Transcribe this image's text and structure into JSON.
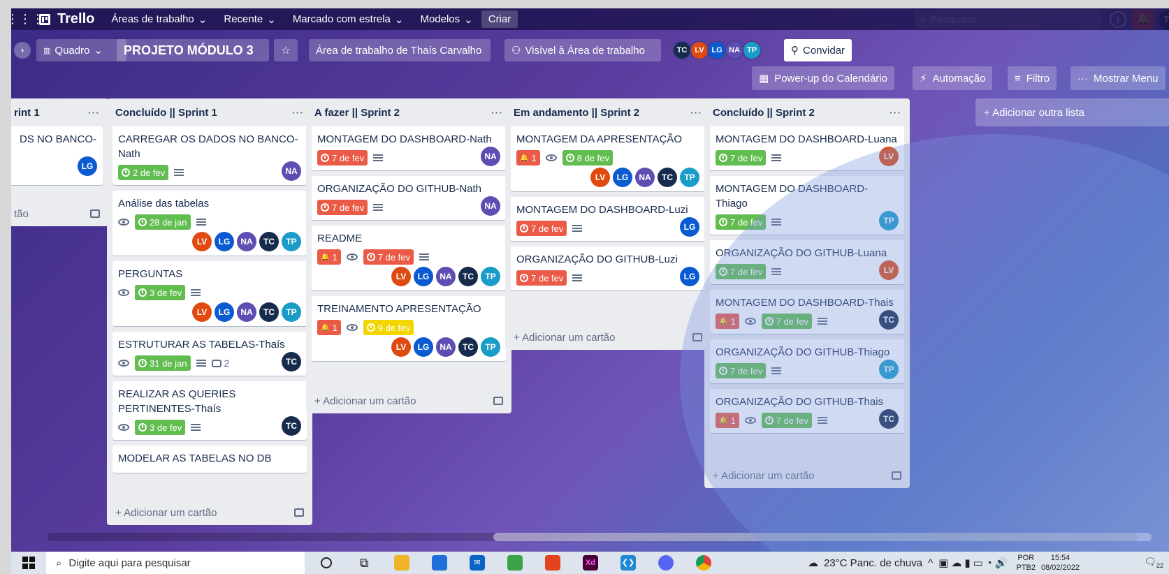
{
  "topbar": {
    "brand": "Trello",
    "nav": [
      "Áreas de trabalho",
      "Recente",
      "Marcado com estrela",
      "Modelos"
    ],
    "create": "Criar",
    "search_placeholder": "Pesquisar",
    "info": "i",
    "user_initials": "TC"
  },
  "board": {
    "view": "Quadro",
    "title": "PROJETO MÓDULO 3",
    "workspace": "Área de trabalho de Thaís Carvalho",
    "visibility": "Visível à Área de trabalho",
    "members": [
      "TC",
      "LV",
      "LG",
      "NA",
      "TP"
    ],
    "invite": "Convidar",
    "calendar": "Power-up do Calendário",
    "automation": "Automação",
    "filter": "Filtro",
    "show_menu": "Mostrar Menu",
    "add_list": "+ Adicionar outra lista"
  },
  "add_card_label": "+ Adicionar um cartão",
  "list0": {
    "title": "rint 1",
    "card0": {
      "title": "DS NO BANCO-",
      "members": [
        "LG"
      ]
    },
    "add": "tão"
  },
  "lists": [
    {
      "title": "Concluído || Sprint 1",
      "cards": [
        {
          "title": "CARREGAR OS DADOS NO BANCO-Nath",
          "badges": [
            {
              "type": "date",
              "color": "green",
              "text": "2 de fev"
            },
            {
              "type": "desc"
            }
          ],
          "members": [
            "NA"
          ]
        },
        {
          "title": "Análise das tabelas",
          "badges": [
            {
              "type": "watch"
            },
            {
              "type": "date",
              "color": "green",
              "text": "28 de jan"
            },
            {
              "type": "desc"
            }
          ],
          "members": [
            "LV",
            "LG",
            "NA",
            "TC",
            "TP"
          ]
        },
        {
          "title": "PERGUNTAS",
          "badges": [
            {
              "type": "watch"
            },
            {
              "type": "date",
              "color": "green",
              "text": "3 de fev"
            },
            {
              "type": "desc"
            }
          ],
          "members": [
            "LV",
            "LG",
            "NA",
            "TC",
            "TP"
          ]
        },
        {
          "title": "ESTRUTURAR AS TABELAS-Thaís",
          "badges": [
            {
              "type": "watch"
            },
            {
              "type": "date",
              "color": "green",
              "text": "31 de jan"
            },
            {
              "type": "desc"
            },
            {
              "type": "comment",
              "text": "2"
            }
          ],
          "members": [
            "TC"
          ]
        },
        {
          "title": "REALIZAR AS QUERIES PERTINENTES-Thaís",
          "badges": [
            {
              "type": "watch"
            },
            {
              "type": "date",
              "color": "green",
              "text": "3 de fev"
            },
            {
              "type": "desc"
            }
          ],
          "members": [
            "TC"
          ]
        },
        {
          "title": "MODELAR AS TABELAS NO DB",
          "badges": [],
          "members": []
        }
      ]
    },
    {
      "title": "A fazer || Sprint 2",
      "cards": [
        {
          "title": "MONTAGEM DO DASHBOARD-Nath",
          "badges": [
            {
              "type": "date",
              "color": "red",
              "text": "7 de fev"
            },
            {
              "type": "desc"
            }
          ],
          "members": [
            "NA"
          ]
        },
        {
          "title": "ORGANIZAÇÃO DO GITHUB-Nath",
          "badges": [
            {
              "type": "date",
              "color": "red",
              "text": "7 de fev"
            },
            {
              "type": "desc"
            }
          ],
          "members": [
            "NA"
          ]
        },
        {
          "title": "README",
          "badges": [
            {
              "type": "alert",
              "text": "1"
            },
            {
              "type": "watch"
            },
            {
              "type": "date",
              "color": "red",
              "text": "7 de fev"
            },
            {
              "type": "desc"
            }
          ],
          "members": [
            "LV",
            "LG",
            "NA",
            "TC",
            "TP"
          ]
        },
        {
          "title": "TREINAMENTO APRESENTAÇÃO",
          "badges": [
            {
              "type": "alert",
              "text": "1"
            },
            {
              "type": "watch"
            },
            {
              "type": "date",
              "color": "yellow",
              "text": "9 de fev"
            }
          ],
          "members": [
            "LV",
            "LG",
            "NA",
            "TC",
            "TP"
          ]
        }
      ]
    },
    {
      "title": "Em andamento || Sprint 2",
      "cards": [
        {
          "title": "MONTAGEM DA APRESENTAÇÃO",
          "badges": [
            {
              "type": "alert",
              "text": "1"
            },
            {
              "type": "watch"
            },
            {
              "type": "date",
              "color": "green",
              "text": "8 de fev"
            }
          ],
          "members": [
            "LV",
            "LG",
            "NA",
            "TC",
            "TP"
          ]
        },
        {
          "title": "MONTAGEM DO DASHBOARD-Luzi",
          "badges": [
            {
              "type": "date",
              "color": "red",
              "text": "7 de fev"
            },
            {
              "type": "desc"
            }
          ],
          "members": [
            "LG"
          ]
        },
        {
          "title": "ORGANIZAÇÃO DO GITHUB-Luzi",
          "badges": [
            {
              "type": "date",
              "color": "red",
              "text": "7 de fev"
            },
            {
              "type": "desc"
            }
          ],
          "members": [
            "LG"
          ]
        }
      ]
    },
    {
      "title": "Concluído || Sprint 2",
      "cards": [
        {
          "title": "MONTAGEM DO DASHBOARD-Luana",
          "badges": [
            {
              "type": "date",
              "color": "green",
              "text": "7 de fev"
            },
            {
              "type": "desc"
            }
          ],
          "members": [
            "LV"
          ]
        },
        {
          "title": "MONTAGEM DO DASHBOARD-Thiago",
          "badges": [
            {
              "type": "date",
              "color": "green",
              "text": "7 de fev"
            },
            {
              "type": "desc"
            }
          ],
          "members": [
            "TP"
          ]
        },
        {
          "title": "ORGANIZAÇÃO DO GITHUB-Luana",
          "badges": [
            {
              "type": "date",
              "color": "green",
              "text": "7 de fev"
            },
            {
              "type": "desc"
            }
          ],
          "members": [
            "LV"
          ]
        },
        {
          "title": "MONTAGEM DO DASHBOARD-Thais",
          "badges": [
            {
              "type": "alert",
              "text": "1"
            },
            {
              "type": "watch"
            },
            {
              "type": "date",
              "color": "green",
              "text": "7 de fev"
            },
            {
              "type": "desc"
            }
          ],
          "members": [
            "TC"
          ]
        },
        {
          "title": "ORGANIZAÇÃO DO GITHUB-Thiago",
          "badges": [
            {
              "type": "date",
              "color": "green",
              "text": "7 de fev"
            },
            {
              "type": "desc"
            }
          ],
          "members": [
            "TP"
          ]
        },
        {
          "title": "ORGANIZAÇÃO DO GITHUB-Thais",
          "badges": [
            {
              "type": "alert",
              "text": "1"
            },
            {
              "type": "watch"
            },
            {
              "type": "date",
              "color": "green",
              "text": "7 de fev"
            },
            {
              "type": "desc"
            }
          ],
          "members": [
            "TC"
          ]
        }
      ]
    }
  ],
  "taskbar": {
    "search_placeholder": "Digite aqui para pesquisar",
    "apps": [
      "task-view",
      "file-explorer",
      "store",
      "mail",
      "minecraft",
      "office",
      "xd",
      "vscode",
      "discord",
      "chrome"
    ],
    "weather": "23°C  Panc. de chuva",
    "lang1": "POR",
    "lang2": "PTB2",
    "time": "15:54",
    "date": "08/02/2022",
    "notifications": "22"
  }
}
